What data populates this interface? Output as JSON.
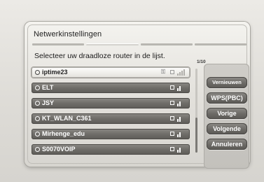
{
  "dialog": {
    "title": "Netwerkinstellingen",
    "instruction": "Selecteer uw draadloze router in de lijst.",
    "page_count": "1/10"
  },
  "networks": [
    {
      "ssid": "iptime23",
      "selected": true,
      "signal_icon": "wifi-signal-weak-icon"
    },
    {
      "ssid": "ELT",
      "selected": false,
      "signal_icon": "wifi-signal-icon"
    },
    {
      "ssid": "JSY",
      "selected": false,
      "signal_icon": "wifi-signal-icon"
    },
    {
      "ssid": "KT_WLAN_C361",
      "selected": false,
      "signal_icon": "wifi-signal-icon"
    },
    {
      "ssid": "Mirhenge_edu",
      "selected": false,
      "signal_icon": "wifi-signal-icon"
    },
    {
      "ssid": "S0070VOIP",
      "selected": false,
      "signal_icon": "wifi-signal-icon"
    }
  ],
  "buttons": {
    "refresh": "Vernieuwen",
    "wps": "WPS(PBC)",
    "previous": "Vorige",
    "next": "Volgende",
    "cancel": "Annuleren"
  },
  "colors": {
    "row_bg": "#6f6d69",
    "row_selected_bg": "#eeede9",
    "button_bg": "#6c6a66"
  }
}
